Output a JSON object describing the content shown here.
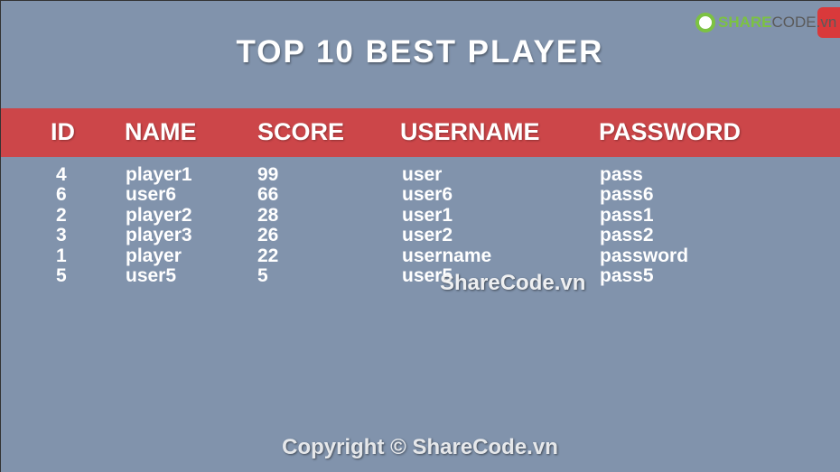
{
  "title": "TOP 10 BEST PLAYER",
  "logo": {
    "brand": "SHARE",
    "brand2": "CODE.vn"
  },
  "colors": {
    "background": "#8193ac",
    "header_band": "#cc4649",
    "text": "#ffffff"
  },
  "columns": [
    "ID",
    "NAME",
    "SCORE",
    "USERNAME",
    "PASSWORD"
  ],
  "rows": [
    [
      "4",
      "player1",
      "99",
      "user",
      "pass"
    ],
    [
      "6",
      "user6",
      "66",
      "user6",
      "pass6"
    ],
    [
      "2",
      "player2",
      "28",
      "user1",
      "pass1"
    ],
    [
      "3",
      "player3",
      "26",
      "user2",
      "pass2"
    ],
    [
      "1",
      "player",
      "22",
      "username",
      "password"
    ],
    [
      "5",
      "user5",
      "5",
      "user5",
      "pass5"
    ]
  ],
  "watermark": "ShareCode.vn",
  "copyright": "Copyright © ShareCode.vn"
}
